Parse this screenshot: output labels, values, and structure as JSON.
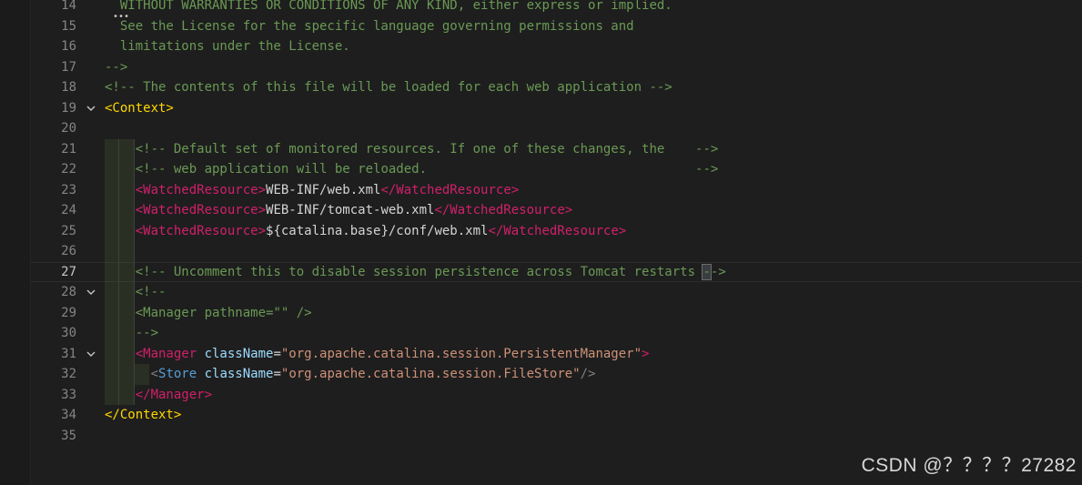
{
  "editor": {
    "lines": [
      {
        "num": "14",
        "fold": "",
        "segments": [
          {
            "t": "WITHOUT WARRANTIES OR CONDITIONS OF ANY KIND, either express or implied.",
            "c": "c-comment",
            "pad": 2
          }
        ]
      },
      {
        "num": "15",
        "fold": "",
        "segments": [
          {
            "t": "See the License for the specific language governing permissions and",
            "c": "c-comment",
            "pad": 2
          }
        ]
      },
      {
        "num": "16",
        "fold": "",
        "segments": [
          {
            "t": "limitations under the License.",
            "c": "c-comment",
            "pad": 2
          }
        ]
      },
      {
        "num": "17",
        "fold": "",
        "segments": [
          {
            "t": "-->",
            "c": "c-comment"
          }
        ]
      },
      {
        "num": "18",
        "fold": "",
        "segments": [
          {
            "t": "<!-- The contents of this file will be loaded for each web application -->",
            "c": "c-comment"
          }
        ]
      },
      {
        "num": "19",
        "fold": "open",
        "segments": [
          {
            "t": "<Context>",
            "c": "c-bracket-y"
          }
        ]
      },
      {
        "num": "20",
        "fold": "",
        "segments": []
      },
      {
        "num": "21",
        "fold": "",
        "indent": 4,
        "segments": [
          {
            "t": "<!-- Default set of monitored resources. If one of these changes, the    -->",
            "c": "c-comment"
          }
        ]
      },
      {
        "num": "22",
        "fold": "",
        "indent": 4,
        "segments": [
          {
            "t": "<!-- web application will be reloaded.                                   -->",
            "c": "c-comment"
          }
        ]
      },
      {
        "num": "23",
        "fold": "",
        "indent": 4,
        "segments": [
          {
            "t": "<WatchedResource>",
            "c": "c-tag-red"
          },
          {
            "t": "WEB-INF/web.xml",
            "c": "c-text"
          },
          {
            "t": "</WatchedResource>",
            "c": "c-tag-red"
          }
        ]
      },
      {
        "num": "24",
        "fold": "",
        "indent": 4,
        "segments": [
          {
            "t": "<WatchedResource>",
            "c": "c-tag-red"
          },
          {
            "t": "WEB-INF/tomcat-web.xml",
            "c": "c-text"
          },
          {
            "t": "</WatchedResource>",
            "c": "c-tag-red"
          }
        ]
      },
      {
        "num": "25",
        "fold": "",
        "indent": 4,
        "segments": [
          {
            "t": "<WatchedResource>",
            "c": "c-tag-red"
          },
          {
            "t": "${catalina.base}/conf/web.xml",
            "c": "c-text"
          },
          {
            "t": "</WatchedResource>",
            "c": "c-tag-red"
          }
        ]
      },
      {
        "num": "26",
        "fold": "",
        "indent": 4,
        "segments": []
      },
      {
        "num": "27",
        "fold": "",
        "indent": 4,
        "current": true,
        "segments": [
          {
            "t": "<!-- Uncomment this to disable session persistence across Tomcat restarts ",
            "c": "c-comment"
          },
          {
            "t": "-",
            "c": "c-comment c-box"
          },
          {
            "t": "->",
            "c": "c-comment"
          }
        ]
      },
      {
        "num": "28",
        "fold": "open",
        "indent": 4,
        "segments": [
          {
            "t": "<!--",
            "c": "c-comment"
          }
        ]
      },
      {
        "num": "29",
        "fold": "",
        "indent": 4,
        "segments": [
          {
            "t": "<Manager pathname=\"\" />",
            "c": "c-comment"
          }
        ]
      },
      {
        "num": "30",
        "fold": "",
        "indent": 4,
        "segments": [
          {
            "t": "-->",
            "c": "c-comment"
          }
        ]
      },
      {
        "num": "31",
        "fold": "open",
        "indent": 4,
        "segments": [
          {
            "t": "<Manager ",
            "c": "c-tag-red"
          },
          {
            "t": "className",
            "c": "c-attr"
          },
          {
            "t": "=",
            "c": "c-text"
          },
          {
            "t": "\"org.apache.catalina.session.PersistentManager\"",
            "c": "c-str"
          },
          {
            "t": ">",
            "c": "c-tag-red"
          }
        ]
      },
      {
        "num": "32",
        "fold": "",
        "indent": 6,
        "segments": [
          {
            "t": "<",
            "c": "c-punct"
          },
          {
            "t": "Store ",
            "c": "c-tag-blue"
          },
          {
            "t": "className",
            "c": "c-attr"
          },
          {
            "t": "=",
            "c": "c-text"
          },
          {
            "t": "\"org.apache.catalina.session.FileStore\"",
            "c": "c-str"
          },
          {
            "t": "/>",
            "c": "c-punct"
          }
        ]
      },
      {
        "num": "33",
        "fold": "",
        "indent": 4,
        "segments": [
          {
            "t": "</Manager>",
            "c": "c-tag-red"
          }
        ]
      },
      {
        "num": "34",
        "fold": "",
        "segments": [
          {
            "t": "</Context>",
            "c": "c-bracket-y"
          }
        ]
      },
      {
        "num": "35",
        "fold": "",
        "segments": []
      }
    ]
  },
  "watermark": {
    "text": "CSDN @？？？？27282"
  },
  "colors": {
    "background": "#1e1e1e",
    "comment": "#6a9955",
    "tag_red": "#d0206a",
    "bracket_yellow": "#ffd700",
    "attr": "#9cdcfe",
    "string": "#ce9178"
  },
  "icons": {
    "fold": "chevron-down-icon",
    "collapsed_marker": "ellipsis-icon"
  }
}
